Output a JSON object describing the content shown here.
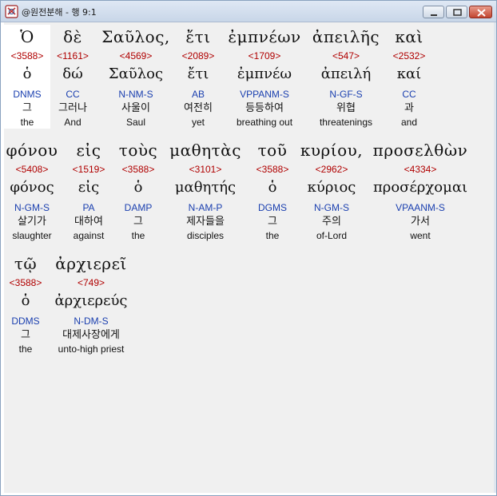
{
  "window": {
    "title": "@원전분해 - 행 9:1",
    "icon": "app-icon"
  },
  "tokens": [
    {
      "greek": "Ὁ",
      "strong": "<3588>",
      "lemma": "ὁ",
      "morph": "DNMS",
      "korean": "그",
      "english": "the"
    },
    {
      "greek": "δὲ",
      "strong": "<1161>",
      "lemma": "δώ",
      "morph": "CC",
      "korean": "그러나",
      "english": "And"
    },
    {
      "greek": "Σαῦλος,",
      "strong": "<4569>",
      "lemma": "Σαῦλος",
      "morph": "N-NM-S",
      "korean": "사울이",
      "english": "Saul"
    },
    {
      "greek": "ἔτι",
      "strong": "<2089>",
      "lemma": "ἔτι",
      "morph": "AB",
      "korean": "여전히",
      "english": "yet"
    },
    {
      "greek": "ἐμπνέων",
      "strong": "<1709>",
      "lemma": "ἐμπνέω",
      "morph": "VPPANM-S",
      "korean": "등등하여",
      "english": "breathing out"
    },
    {
      "greek": "ἀπειλῆς",
      "strong": "<547>",
      "lemma": "ἀπειλή",
      "morph": "N-GF-S",
      "korean": "위협",
      "english": "threatenings"
    },
    {
      "greek": "καὶ",
      "strong": "<2532>",
      "lemma": "καί",
      "morph": "CC",
      "korean": "과",
      "english": "and"
    },
    {
      "greek": "φόνου",
      "strong": "<5408>",
      "lemma": "φόνος",
      "morph": "N-GM-S",
      "korean": "살기가",
      "english": "slaughter"
    },
    {
      "greek": "εἰς",
      "strong": "<1519>",
      "lemma": "εἰς",
      "morph": "PA",
      "korean": "대하여",
      "english": "against"
    },
    {
      "greek": "τοὺς",
      "strong": "<3588>",
      "lemma": "ὁ",
      "morph": "DAMP",
      "korean": "그",
      "english": "the"
    },
    {
      "greek": "μαθητὰς",
      "strong": "<3101>",
      "lemma": "μαθητής",
      "morph": "N-AM-P",
      "korean": "제자들을",
      "english": "disciples"
    },
    {
      "greek": "τοῦ",
      "strong": "<3588>",
      "lemma": "ὁ",
      "morph": "DGMS",
      "korean": "그",
      "english": "the"
    },
    {
      "greek": "κυρίου,",
      "strong": "<2962>",
      "lemma": "κύριος",
      "morph": "N-GM-S",
      "korean": "주의",
      "english": "of-Lord"
    },
    {
      "greek": "προσελθὼν",
      "strong": "<4334>",
      "lemma": "προσέρχομαι",
      "morph": "VPAANM-S",
      "korean": "가서",
      "english": "went"
    },
    {
      "greek": "τῷ",
      "strong": "<3588>",
      "lemma": "ὁ",
      "morph": "DDMS",
      "korean": "그",
      "english": "the"
    },
    {
      "greek": "ἀρχιερεῖ",
      "strong": "<749>",
      "lemma": "ἀρχιερεύς",
      "morph": "N-DM-S",
      "korean": "대제사장에게",
      "english": "unto-high priest"
    }
  ],
  "colors": {
    "strong": "#b00000",
    "morph": "#1a3faf",
    "highlight": "#ffffff",
    "background": "#f0f0f0"
  }
}
